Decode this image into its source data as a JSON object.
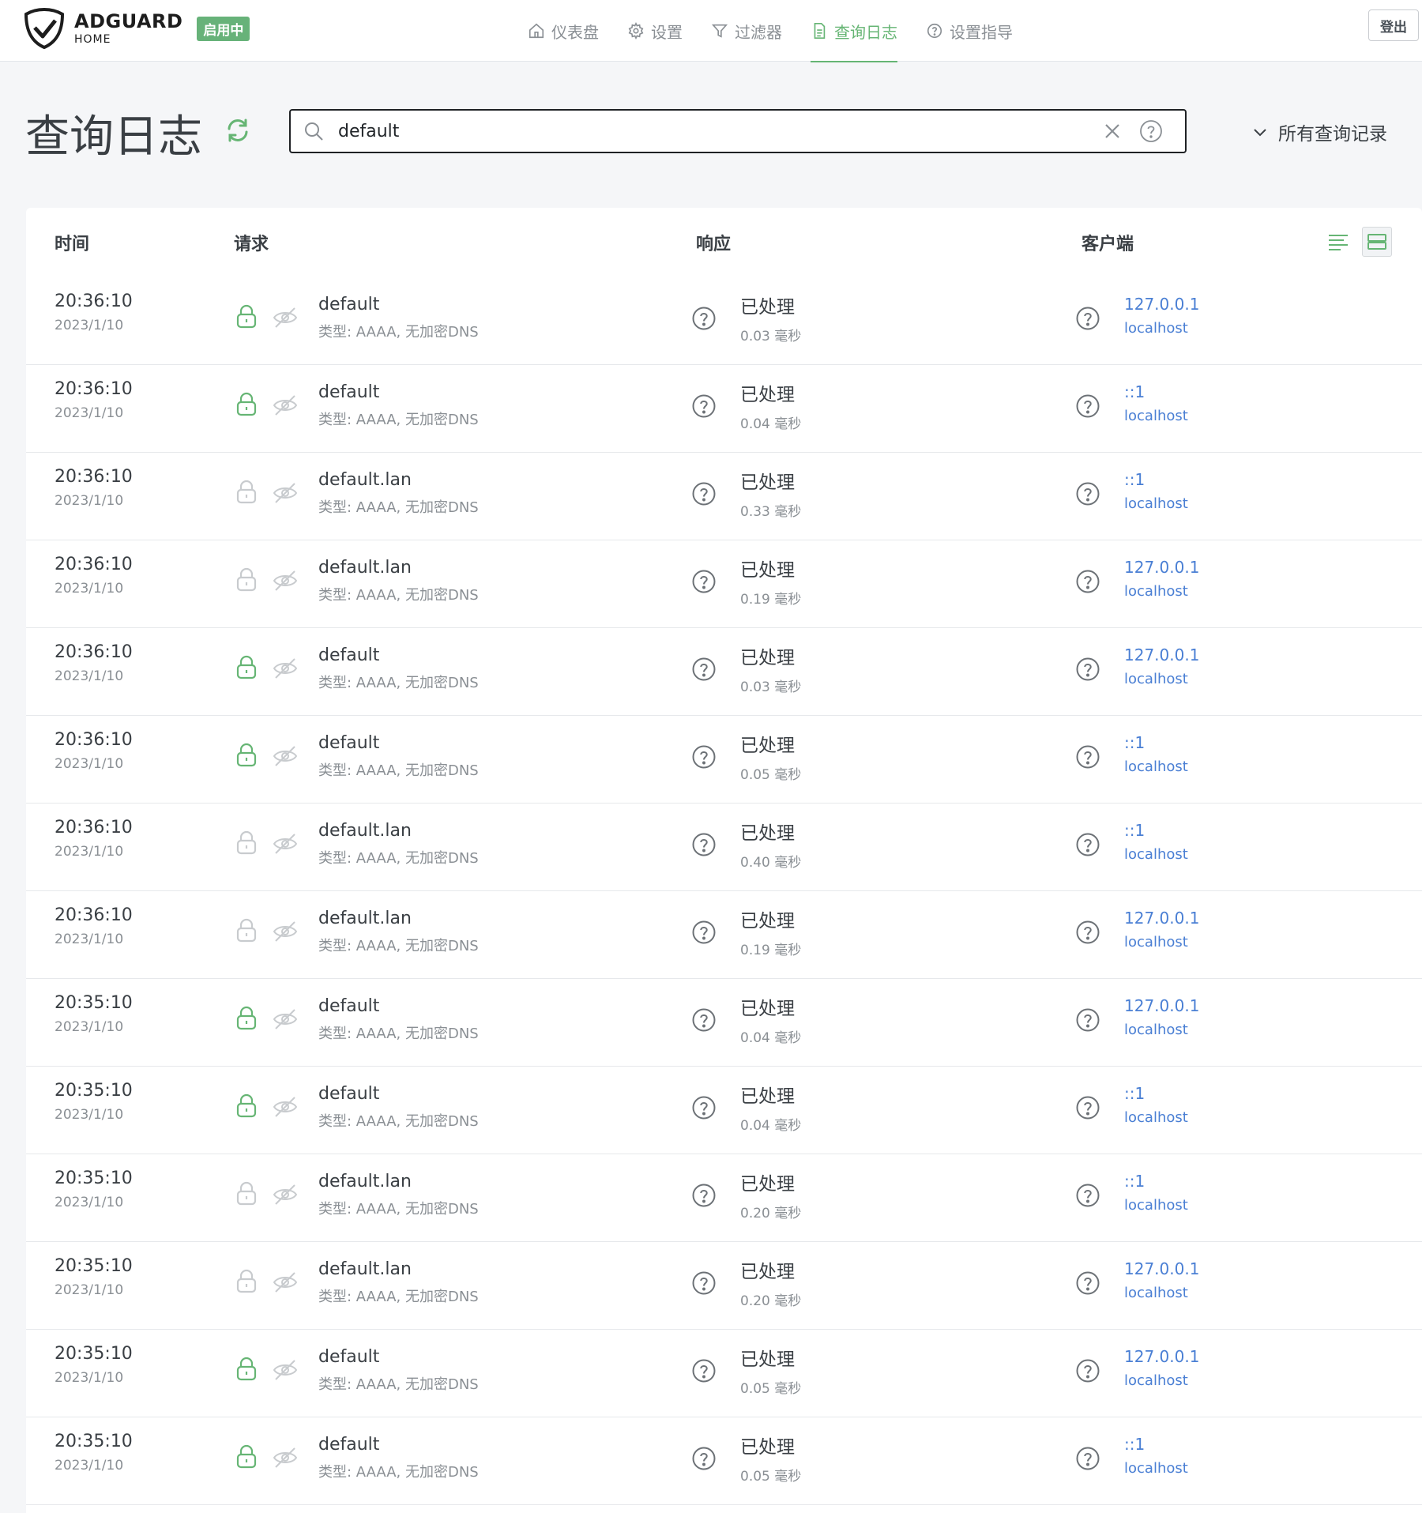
{
  "header": {
    "brand_name": "ADGUARD",
    "brand_sub": "HOME",
    "status_badge": "启用中",
    "logout_label": "登出",
    "nav": [
      {
        "label": "仪表盘",
        "icon": "home-icon",
        "active": false
      },
      {
        "label": "设置",
        "icon": "gear-icon",
        "active": false
      },
      {
        "label": "过滤器",
        "icon": "filter-icon",
        "active": false
      },
      {
        "label": "查询日志",
        "icon": "document-icon",
        "active": true
      },
      {
        "label": "设置指导",
        "icon": "help-circle-icon",
        "active": false
      }
    ]
  },
  "page": {
    "title": "查询日志",
    "search_value": "default",
    "filter_label": "所有查询记录"
  },
  "table": {
    "columns": {
      "time": "时间",
      "request": "请求",
      "response": "响应",
      "client": "客户端"
    },
    "rows": [
      {
        "time": "20:36:10",
        "date": "2023/1/10",
        "domain": "default",
        "type": "类型: AAAA, 无加密DNS",
        "locked": true,
        "status": "已处理",
        "elapsed": "0.03 毫秒",
        "ip": "127.0.0.1",
        "host": "localhost"
      },
      {
        "time": "20:36:10",
        "date": "2023/1/10",
        "domain": "default",
        "type": "类型: AAAA, 无加密DNS",
        "locked": true,
        "status": "已处理",
        "elapsed": "0.04 毫秒",
        "ip": "::1",
        "host": "localhost"
      },
      {
        "time": "20:36:10",
        "date": "2023/1/10",
        "domain": "default.lan",
        "type": "类型: AAAA, 无加密DNS",
        "locked": false,
        "status": "已处理",
        "elapsed": "0.33 毫秒",
        "ip": "::1",
        "host": "localhost"
      },
      {
        "time": "20:36:10",
        "date": "2023/1/10",
        "domain": "default.lan",
        "type": "类型: AAAA, 无加密DNS",
        "locked": false,
        "status": "已处理",
        "elapsed": "0.19 毫秒",
        "ip": "127.0.0.1",
        "host": "localhost"
      },
      {
        "time": "20:36:10",
        "date": "2023/1/10",
        "domain": "default",
        "type": "类型: AAAA, 无加密DNS",
        "locked": true,
        "status": "已处理",
        "elapsed": "0.03 毫秒",
        "ip": "127.0.0.1",
        "host": "localhost"
      },
      {
        "time": "20:36:10",
        "date": "2023/1/10",
        "domain": "default",
        "type": "类型: AAAA, 无加密DNS",
        "locked": true,
        "status": "已处理",
        "elapsed": "0.05 毫秒",
        "ip": "::1",
        "host": "localhost"
      },
      {
        "time": "20:36:10",
        "date": "2023/1/10",
        "domain": "default.lan",
        "type": "类型: AAAA, 无加密DNS",
        "locked": false,
        "status": "已处理",
        "elapsed": "0.40 毫秒",
        "ip": "::1",
        "host": "localhost"
      },
      {
        "time": "20:36:10",
        "date": "2023/1/10",
        "domain": "default.lan",
        "type": "类型: AAAA, 无加密DNS",
        "locked": false,
        "status": "已处理",
        "elapsed": "0.19 毫秒",
        "ip": "127.0.0.1",
        "host": "localhost"
      },
      {
        "time": "20:35:10",
        "date": "2023/1/10",
        "domain": "default",
        "type": "类型: AAAA, 无加密DNS",
        "locked": true,
        "status": "已处理",
        "elapsed": "0.04 毫秒",
        "ip": "127.0.0.1",
        "host": "localhost"
      },
      {
        "time": "20:35:10",
        "date": "2023/1/10",
        "domain": "default",
        "type": "类型: AAAA, 无加密DNS",
        "locked": true,
        "status": "已处理",
        "elapsed": "0.04 毫秒",
        "ip": "::1",
        "host": "localhost"
      },
      {
        "time": "20:35:10",
        "date": "2023/1/10",
        "domain": "default.lan",
        "type": "类型: AAAA, 无加密DNS",
        "locked": false,
        "status": "已处理",
        "elapsed": "0.20 毫秒",
        "ip": "::1",
        "host": "localhost"
      },
      {
        "time": "20:35:10",
        "date": "2023/1/10",
        "domain": "default.lan",
        "type": "类型: AAAA, 无加密DNS",
        "locked": false,
        "status": "已处理",
        "elapsed": "0.20 毫秒",
        "ip": "127.0.0.1",
        "host": "localhost"
      },
      {
        "time": "20:35:10",
        "date": "2023/1/10",
        "domain": "default",
        "type": "类型: AAAA, 无加密DNS",
        "locked": true,
        "status": "已处理",
        "elapsed": "0.05 毫秒",
        "ip": "127.0.0.1",
        "host": "localhost"
      },
      {
        "time": "20:35:10",
        "date": "2023/1/10",
        "domain": "default",
        "type": "类型: AAAA, 无加密DNS",
        "locked": true,
        "status": "已处理",
        "elapsed": "0.05 毫秒",
        "ip": "::1",
        "host": "localhost"
      }
    ]
  },
  "colors": {
    "accent": "#66b574",
    "link": "#4a7fd4",
    "muted": "#8a8f94",
    "icon_inactive": "#c8cbce"
  }
}
